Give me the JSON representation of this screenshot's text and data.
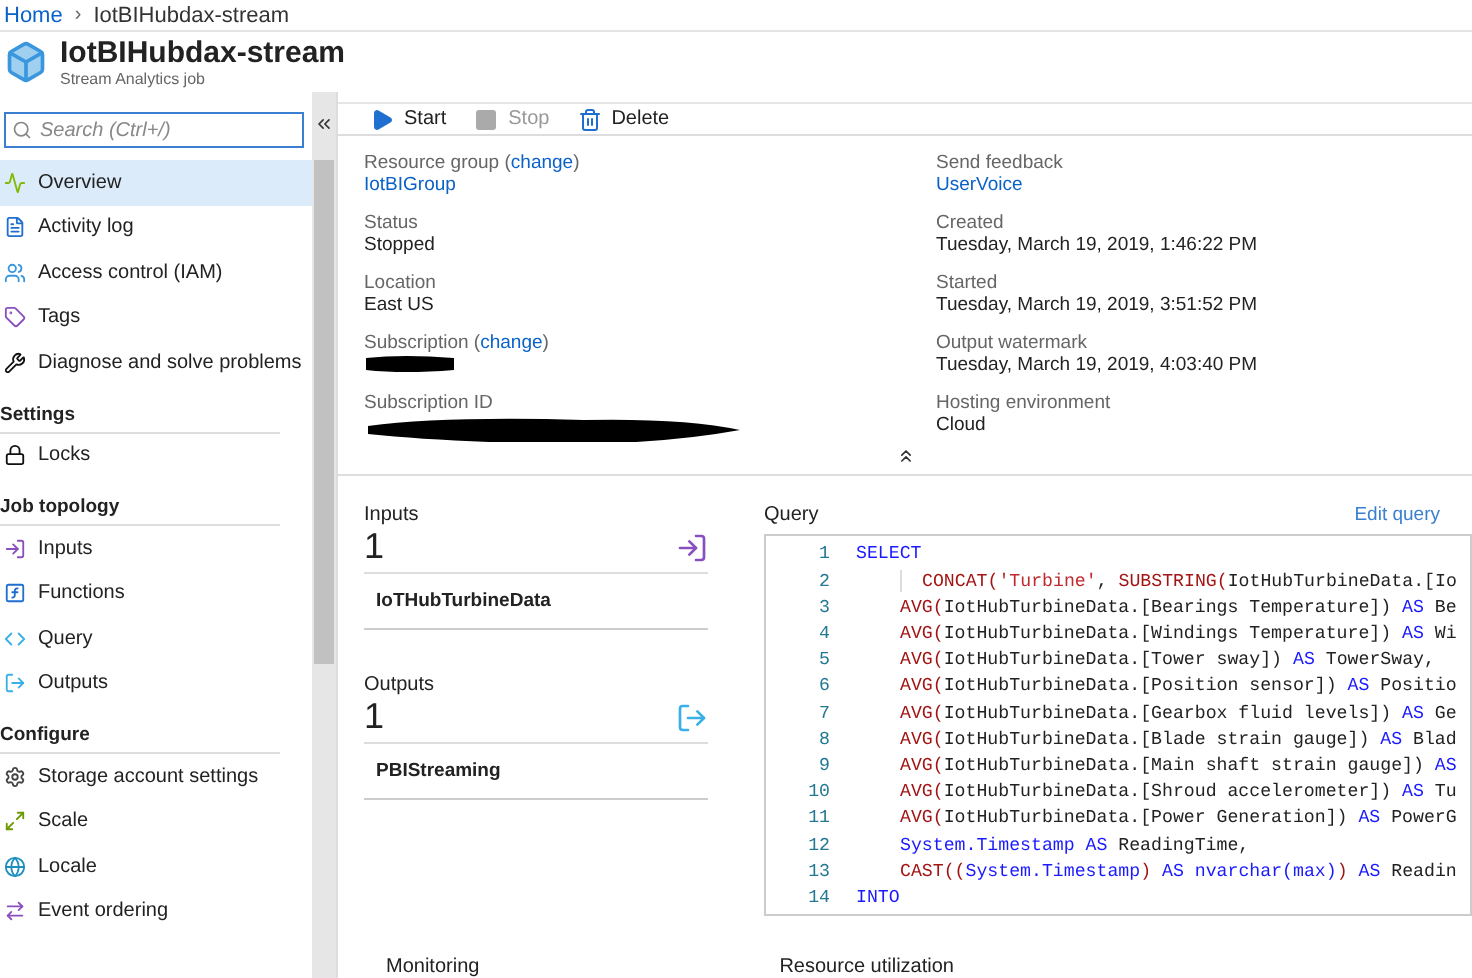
{
  "breadcrumb": [
    {
      "label": "Home",
      "kind": "link"
    },
    {
      "separator": "›",
      "label": "IotBIHubdax-stream",
      "kind": "current"
    }
  ],
  "header": {
    "title": "IotBIHubdax-stream",
    "subtitle": "Stream Analytics job"
  },
  "sidebar": {
    "search": {
      "placeholder": "Search (Ctrl+/)"
    },
    "sections": [
      {
        "items": [
          {
            "label": "Overview",
            "selected": true
          },
          {
            "label": "Activity log",
            "selected": false
          },
          {
            "label": "Access control (IAM)",
            "selected": false
          },
          {
            "label": "Tags",
            "selected": false
          },
          {
            "label": "Diagnose and solve problems",
            "selected": false
          }
        ]
      },
      {
        "heading": "Settings",
        "items": [
          {
            "label": "Locks",
            "selected": false
          }
        ]
      },
      {
        "heading": "Job topology",
        "items": [
          {
            "label": "Inputs",
            "selected": false
          },
          {
            "label": "Functions",
            "selected": false
          },
          {
            "label": "Query",
            "selected": false
          },
          {
            "label": "Outputs",
            "selected": false
          }
        ]
      },
      {
        "heading": "Configure",
        "items": [
          {
            "label": "Storage account settings",
            "selected": false
          },
          {
            "label": "Scale",
            "selected": false
          },
          {
            "label": "Locale",
            "selected": false
          },
          {
            "label": "Event ordering",
            "selected": false
          }
        ]
      }
    ]
  },
  "toolbar": [
    {
      "label": "Start",
      "disabled": false
    },
    {
      "label": "Stop",
      "disabled": true
    },
    {
      "label": "Delete",
      "disabled": false
    }
  ],
  "essentials": {
    "left": [
      {
        "label": "Resource group",
        "paren_open": "(",
        "change": "change",
        "paren_close": ")",
        "value": "IotBIGroup",
        "link": true
      },
      {
        "label": "Status",
        "value": "Stopped",
        "link": false
      },
      {
        "label": "Location",
        "value": "East US",
        "link": false
      },
      {
        "label": "Subscription",
        "paren_open": "(",
        "change": "change",
        "paren_close": ")",
        "redacted": true
      },
      {
        "label": "Subscription ID",
        "redacted": true
      }
    ],
    "right": [
      {
        "label": "Send feedback",
        "value": "UserVoice",
        "link": true
      },
      {
        "label": "Created",
        "value": "Tuesday, March 19, 2019, 1:46:22 PM",
        "link": false
      },
      {
        "label": "Started",
        "value": "Tuesday, March 19, 2019, 3:51:52 PM",
        "link": false
      },
      {
        "label": "Output watermark",
        "value": "Tuesday, March 19, 2019, 4:03:40 PM",
        "link": false
      },
      {
        "label": "Hosting environment",
        "value": "Cloud",
        "link": false
      }
    ]
  },
  "topology": [
    {
      "kind": "input",
      "title": "Inputs",
      "count": "1",
      "items": [
        "IoTHubTurbineData"
      ]
    },
    {
      "kind": "output",
      "title": "Outputs",
      "count": "1",
      "items": [
        "PBIStreaming"
      ]
    }
  ],
  "query": {
    "title": "Query",
    "edit_link": "Edit query",
    "lines": [
      {
        "number": "1",
        "kind": "none",
        "tokens": [
          {
            "kind": "kw",
            "text": "SELECT"
          }
        ]
      },
      {
        "number": "2",
        "kind": "deep",
        "tokens": [
          {
            "kind": "fn",
            "text": "CONCAT("
          },
          {
            "kind": "str",
            "text": "'Turbine'"
          },
          {
            "kind": "txt",
            "text": ", "
          },
          {
            "kind": "fn",
            "text": "SUBSTRING("
          },
          {
            "kind": "txt",
            "text": "IotHubTurbineData.[Io"
          }
        ]
      },
      {
        "number": "3",
        "kind": "one",
        "tokens": [
          {
            "kind": "fn",
            "text": "AVG("
          },
          {
            "kind": "txt",
            "text": "IotHubTurbineData.[Bearings Temperature]) "
          },
          {
            "kind": "kw",
            "text": "AS"
          },
          {
            "kind": "txt",
            "text": " Be"
          }
        ]
      },
      {
        "number": "4",
        "kind": "one",
        "tokens": [
          {
            "kind": "fn",
            "text": "AVG("
          },
          {
            "kind": "txt",
            "text": "IotHubTurbineData.[Windings Temperature]) "
          },
          {
            "kind": "kw",
            "text": "AS"
          },
          {
            "kind": "txt",
            "text": " Wi"
          }
        ]
      },
      {
        "number": "5",
        "kind": "one",
        "tokens": [
          {
            "kind": "fn",
            "text": "AVG("
          },
          {
            "kind": "txt",
            "text": "IotHubTurbineData.[Tower sway]) "
          },
          {
            "kind": "kw",
            "text": "AS"
          },
          {
            "kind": "txt",
            "text": " TowerSway,"
          }
        ]
      },
      {
        "number": "6",
        "kind": "one",
        "tokens": [
          {
            "kind": "fn",
            "text": "AVG("
          },
          {
            "kind": "txt",
            "text": "IotHubTurbineData.[Position sensor]) "
          },
          {
            "kind": "kw",
            "text": "AS"
          },
          {
            "kind": "txt",
            "text": " Positio"
          }
        ]
      },
      {
        "number": "7",
        "kind": "one",
        "tokens": [
          {
            "kind": "fn",
            "text": "AVG("
          },
          {
            "kind": "txt",
            "text": "IotHubTurbineData.[Gearbox fluid levels]) "
          },
          {
            "kind": "kw",
            "text": "AS"
          },
          {
            "kind": "txt",
            "text": " Ge"
          }
        ]
      },
      {
        "number": "8",
        "kind": "one",
        "tokens": [
          {
            "kind": "fn",
            "text": "AVG("
          },
          {
            "kind": "txt",
            "text": "IotHubTurbineData.[Blade strain gauge]) "
          },
          {
            "kind": "kw",
            "text": "AS"
          },
          {
            "kind": "txt",
            "text": " Blad"
          }
        ]
      },
      {
        "number": "9",
        "kind": "one",
        "tokens": [
          {
            "kind": "fn",
            "text": "AVG("
          },
          {
            "kind": "txt",
            "text": "IotHubTurbineData.[Main shaft strain gauge]) "
          },
          {
            "kind": "kw",
            "text": "AS"
          }
        ]
      },
      {
        "number": "10",
        "kind": "one",
        "tokens": [
          {
            "kind": "fn",
            "text": "AVG("
          },
          {
            "kind": "txt",
            "text": "IotHubTurbineData.[Shroud accelerometer]) "
          },
          {
            "kind": "kw",
            "text": "AS"
          },
          {
            "kind": "txt",
            "text": " Tu"
          }
        ]
      },
      {
        "number": "11",
        "kind": "one",
        "tokens": [
          {
            "kind": "fn",
            "text": "AVG("
          },
          {
            "kind": "txt",
            "text": "IotHubTurbineData.[Power Generation]) "
          },
          {
            "kind": "kw",
            "text": "AS"
          },
          {
            "kind": "txt",
            "text": " PowerG"
          }
        ]
      },
      {
        "number": "12",
        "kind": "one",
        "tokens": [
          {
            "kind": "kw",
            "text": "System.Timestamp AS"
          },
          {
            "kind": "txt",
            "text": " ReadingTime,"
          }
        ]
      },
      {
        "number": "13",
        "kind": "one",
        "tokens": [
          {
            "kind": "fn",
            "text": "CAST(("
          },
          {
            "kind": "kw",
            "text": "System.Timestamp"
          },
          {
            "kind": "fn",
            "text": ") "
          },
          {
            "kind": "kw",
            "text": "AS nvarchar(max)"
          },
          {
            "kind": "fn",
            "text": ") "
          },
          {
            "kind": "kw",
            "text": "AS"
          },
          {
            "kind": "txt",
            "text": " Readin"
          }
        ]
      },
      {
        "number": "14",
        "kind": "none",
        "tokens": [
          {
            "kind": "kw",
            "text": "INTO"
          }
        ]
      }
    ]
  },
  "bottom_tiles": [
    "Monitoring",
    "Resource utilization"
  ]
}
